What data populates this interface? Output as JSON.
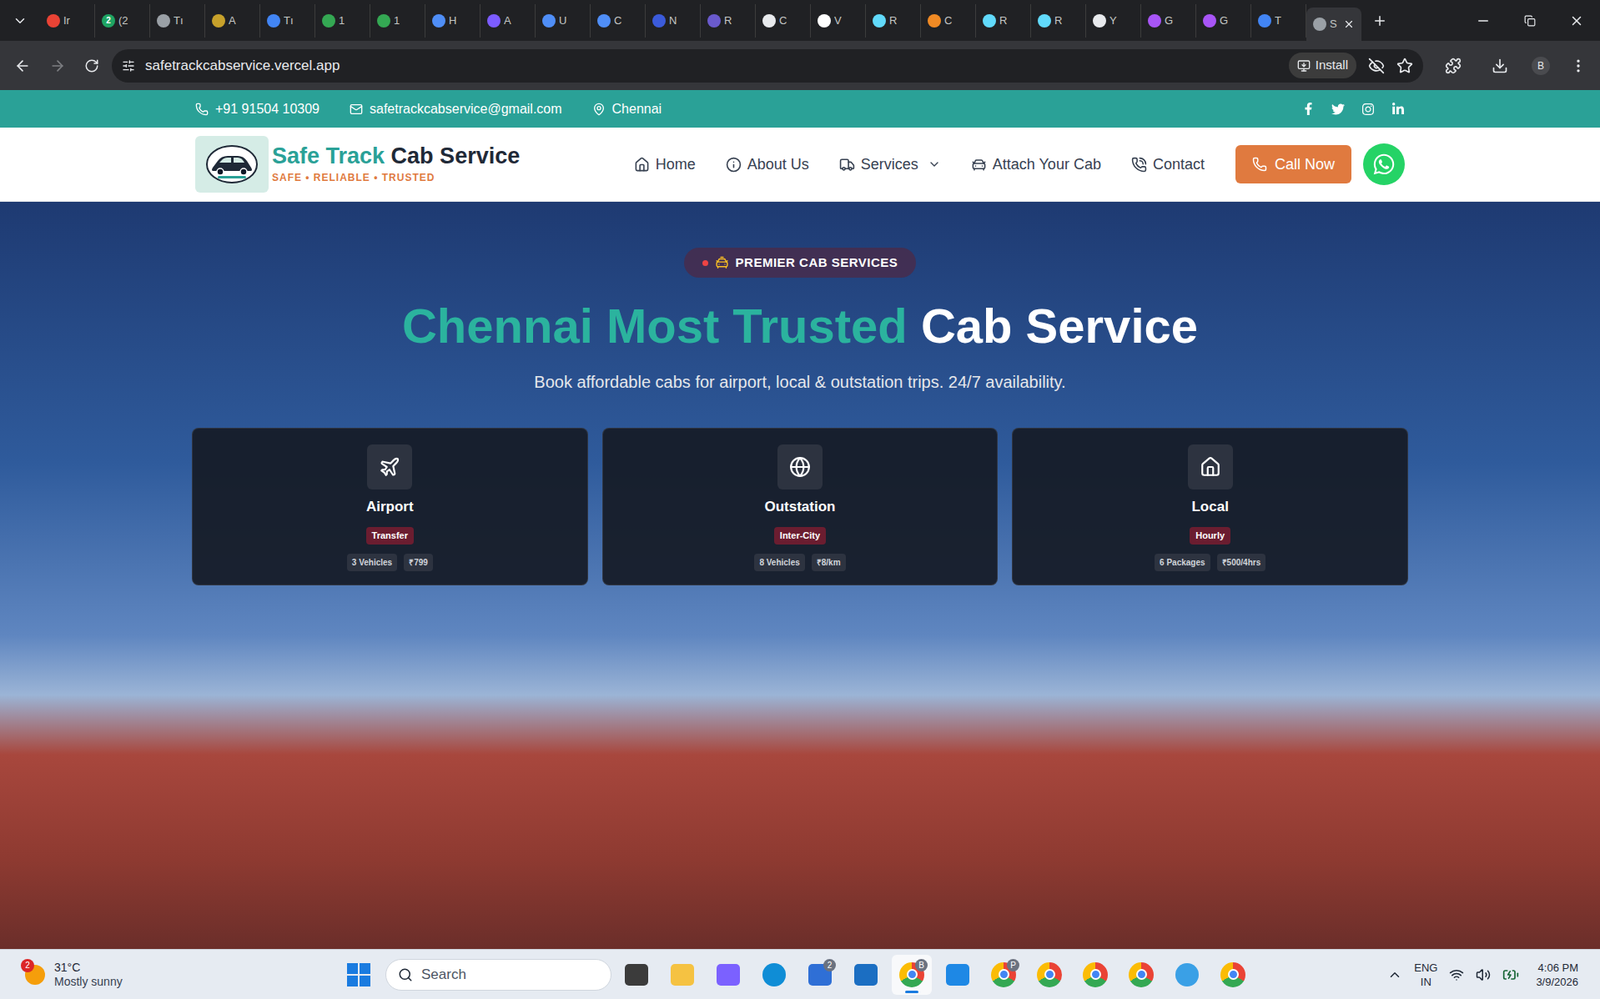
{
  "browser": {
    "tabs": [
      {
        "label": "Ir",
        "color": "#ea4335",
        "badge": "",
        "selected": false
      },
      {
        "label": "(2",
        "color": "#1fa463",
        "badge": "2",
        "selected": false
      },
      {
        "label": "Tı",
        "color": "#9aa0a6",
        "badge": "",
        "selected": false
      },
      {
        "label": "A",
        "color": "#c7a12b",
        "badge": "",
        "selected": false
      },
      {
        "label": "Tı",
        "color": "#4285f4",
        "badge": "",
        "selected": false
      },
      {
        "label": "1",
        "color": "#34a853",
        "badge": "",
        "selected": false
      },
      {
        "label": "1",
        "color": "#34a853",
        "badge": "",
        "selected": false
      },
      {
        "label": "H",
        "color": "#4f8ef7",
        "badge": "",
        "selected": false
      },
      {
        "label": "A",
        "color": "#7c5cff",
        "badge": "",
        "selected": false
      },
      {
        "label": "U",
        "color": "#4f8ef7",
        "badge": "",
        "selected": false
      },
      {
        "label": "C",
        "color": "#4f8ef7",
        "badge": "",
        "selected": false
      },
      {
        "label": "N",
        "color": "#3b5bdb",
        "badge": "",
        "selected": false
      },
      {
        "label": "R",
        "color": "#6a5acd",
        "badge": "",
        "selected": false
      },
      {
        "label": "C",
        "color": "#e8eaed",
        "badge": "",
        "selected": false
      },
      {
        "label": "V",
        "color": "#ffffff",
        "badge": "",
        "selected": false
      },
      {
        "label": "R",
        "color": "#61dafb",
        "badge": "",
        "selected": false
      },
      {
        "label": "C",
        "color": "#f08a24",
        "badge": "",
        "selected": false
      },
      {
        "label": "R",
        "color": "#61dafb",
        "badge": "",
        "selected": false
      },
      {
        "label": "R",
        "color": "#61dafb",
        "badge": "",
        "selected": false
      },
      {
        "label": "Y",
        "color": "#e8eaed",
        "badge": "",
        "selected": false
      },
      {
        "label": "G",
        "color": "#a855f7",
        "badge": "",
        "selected": false
      },
      {
        "label": "G",
        "color": "#a855f7",
        "badge": "",
        "selected": false
      },
      {
        "label": "T",
        "color": "#4285f4",
        "badge": "",
        "selected": false
      },
      {
        "label": "S",
        "color": "#9aa0a6",
        "badge": "",
        "selected": true
      }
    ],
    "url": "safetrackcabservice.vercel.app",
    "install": "Install",
    "profile": "B"
  },
  "topbar": {
    "phone": "+91 91504 10309",
    "email": "safetrackcabservice@gmail.com",
    "location": "Chennai"
  },
  "brand": {
    "name_accent": "Safe Track",
    "name_rest": "Cab Service",
    "tagline": "SAFE • RELIABLE • TRUSTED"
  },
  "nav": [
    {
      "label": "Home",
      "dropdown": false
    },
    {
      "label": "About Us",
      "dropdown": false
    },
    {
      "label": "Services",
      "dropdown": true
    },
    {
      "label": "Attach Your Cab",
      "dropdown": false
    },
    {
      "label": "Contact",
      "dropdown": false
    }
  ],
  "call_button": "Call Now",
  "hero": {
    "badge": "PREMIER CAB SERVICES",
    "title_accent": "Chennai Most Trusted",
    "title_rest": "Cab Service",
    "subtitle": "Book affordable cabs for airport, local & outstation trips. 24/7 availability.",
    "cards": [
      {
        "title": "Airport",
        "tag": "Transfer",
        "chips": [
          "3 Vehicles",
          "₹799"
        ]
      },
      {
        "title": "Outstation",
        "tag": "Inter-City",
        "chips": [
          "8 Vehicles",
          "₹8/km"
        ]
      },
      {
        "title": "Local",
        "tag": "Hourly",
        "chips": [
          "6 Packages",
          "₹500/4hrs"
        ]
      }
    ]
  },
  "taskbar": {
    "weather": {
      "badge": "2",
      "temp": "31°C",
      "condition": "Mostly sunny"
    },
    "search": "Search",
    "apps": [
      {
        "kind": "tile",
        "color": "#3b3b3b",
        "badge": "",
        "selected": false
      },
      {
        "kind": "tile",
        "color": "#f5c242",
        "badge": "",
        "selected": false
      },
      {
        "kind": "tile",
        "color": "#7b61ff",
        "badge": "",
        "selected": false
      },
      {
        "kind": "circle",
        "color": "#0f8dd6",
        "badge": "",
        "selected": false
      },
      {
        "kind": "tile",
        "color": "#2f6fd6",
        "badge": "2",
        "selected": false
      },
      {
        "kind": "tile",
        "color": "#1b6ec2",
        "badge": "",
        "selected": false
      },
      {
        "kind": "chrome",
        "color": "#4285f4",
        "badge": "B",
        "selected": true
      },
      {
        "kind": "tile",
        "color": "#1e88e5",
        "badge": "",
        "selected": false
      },
      {
        "kind": "chrome",
        "color": "#4285f4",
        "badge": "P",
        "selected": false
      },
      {
        "kind": "chrome",
        "color": "#4285f4",
        "badge": "",
        "selected": false
      },
      {
        "kind": "chrome",
        "color": "#4285f4",
        "badge": "",
        "selected": false
      },
      {
        "kind": "chrome",
        "color": "#4285f4",
        "badge": "",
        "selected": false
      },
      {
        "kind": "circle",
        "color": "#3aa0e6",
        "badge": "",
        "selected": false
      },
      {
        "kind": "chrome",
        "color": "#4285f4",
        "badge": "",
        "selected": false
      }
    ],
    "lang": "ENG",
    "region": "IN",
    "time": "4:06 PM",
    "date": "3/9/2026"
  }
}
